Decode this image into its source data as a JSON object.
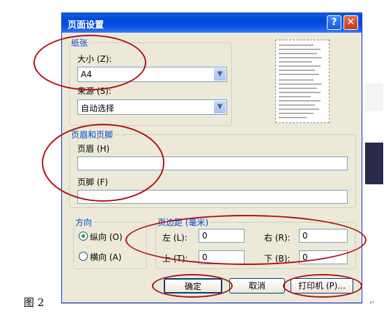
{
  "dialog": {
    "title": "页面设置",
    "help_icon": "?",
    "close_icon": "✕"
  },
  "paper": {
    "legend": "纸张",
    "size_label": "大小 (Z):",
    "size_value": "A4",
    "source_label": "来源 (S):",
    "source_value": "自动选择"
  },
  "header_footer": {
    "legend": "页眉和页脚",
    "header_label": "页眉 (H)",
    "header_value": "",
    "footer_label": "页脚 (F)",
    "footer_value": ""
  },
  "orientation": {
    "legend": "方向",
    "portrait_label": "纵向 (O)",
    "landscape_label": "横向 (A)",
    "selected": "portrait"
  },
  "margins": {
    "legend": "页边距 (毫米)",
    "left_label": "左 (L):",
    "left_value": "0",
    "right_label": "右 (R):",
    "right_value": "0",
    "top_label": "上 (T):",
    "top_value": "0",
    "bottom_label": "下 (B):",
    "bottom_value": "0"
  },
  "buttons": {
    "ok": "确定",
    "cancel": "取消",
    "printer": "打印机 (P)..."
  },
  "caption": "图 2",
  "colors": {
    "annotation": "#b01010",
    "title_bar": "#0a56e8",
    "legend": "#0046d5"
  }
}
